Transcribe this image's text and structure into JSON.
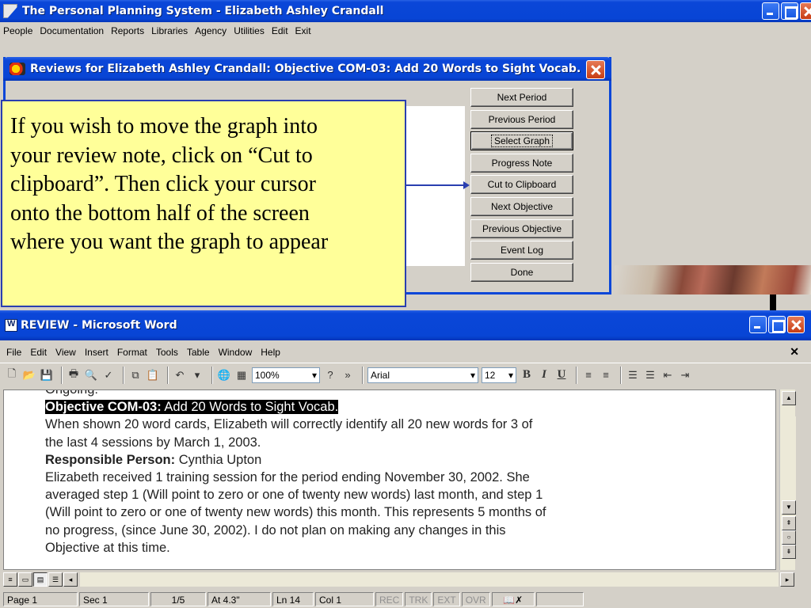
{
  "app": {
    "title": "The Personal Planning System - Elizabeth Ashley Crandall",
    "menu": [
      "People",
      "Documentation",
      "Reports",
      "Libraries",
      "Agency",
      "Utilities",
      "Edit",
      "Exit"
    ]
  },
  "dialog": {
    "title": "Reviews for Elizabeth Ashley Crandall: Objective COM-03: Add 20 Words to Sight Vocab.",
    "buttons": [
      "Next Period",
      "Previous Period",
      "Select Graph",
      "Progress Note",
      "Cut to Clipboard",
      "Next Objective",
      "Previous Objective",
      "Event Log",
      "Done"
    ]
  },
  "callout": {
    "lines": [
      "If you wish to move the graph into",
      "your review note, click on “Cut to",
      "clipboard”. Then click your cursor",
      "onto the bottom half of the screen",
      "where you want the graph to appear"
    ]
  },
  "word": {
    "title": "REVIEW - Microsoft Word",
    "menu": [
      "File",
      "Edit",
      "View",
      "Insert",
      "Format",
      "Tools",
      "Table",
      "Window",
      "Help"
    ],
    "toolbar": {
      "zoom": "100%",
      "font": "Arial",
      "size": "12",
      "bold": "B",
      "italic": "I",
      "underline": "U"
    },
    "doc": {
      "cut_top": "Ongoing:",
      "objective_label": "Objective COM-03:",
      "objective_text": " Add 20 Words to Sight Vocab.",
      "para1": [
        "When shown 20 word cards, Elizabeth will correctly identify all 20 new words for 3 of",
        "the last 4 sessions by March 1, 2003."
      ],
      "responsible_label": "Responsible Person:",
      "responsible_name": "  Cynthia Upton",
      "para2": [
        "Elizabeth received 1 training session for the period ending November 30, 2002.  She",
        "averaged step 1 (Will point to zero or one of twenty new words) last month, and step 1",
        "(Will point to zero or one of twenty new words) this month.  This represents 5 months of",
        "no progress, (since June 30, 2002).  I do not plan on making any changes in this",
        "Objective at this time."
      ]
    },
    "status": {
      "page": "Page 1",
      "sec": "Sec 1",
      "pages": "1/5",
      "at": "At 4.3\"",
      "ln": "Ln 14",
      "col": "Col 1",
      "rec": "REC",
      "trk": "TRK",
      "ext": "EXT",
      "ovr": "OVR"
    }
  }
}
